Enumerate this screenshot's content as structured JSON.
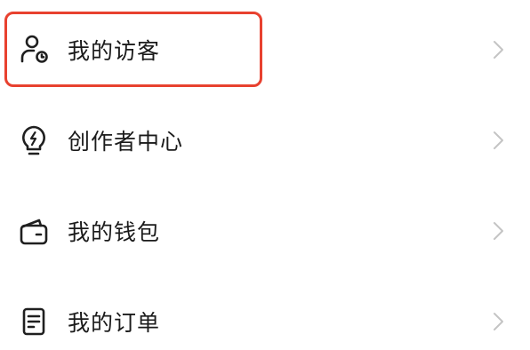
{
  "menu": {
    "items": [
      {
        "label": "我的访客",
        "icon": "visitor-icon"
      },
      {
        "label": "创作者中心",
        "icon": "lightbulb-icon"
      },
      {
        "label": "我的钱包",
        "icon": "wallet-icon"
      },
      {
        "label": "我的订单",
        "icon": "order-icon"
      }
    ]
  },
  "colors": {
    "highlight": "#e8412f",
    "text": "#1b1b1b",
    "icon": "#1f1f1f",
    "chevron": "#c4c4c4"
  }
}
